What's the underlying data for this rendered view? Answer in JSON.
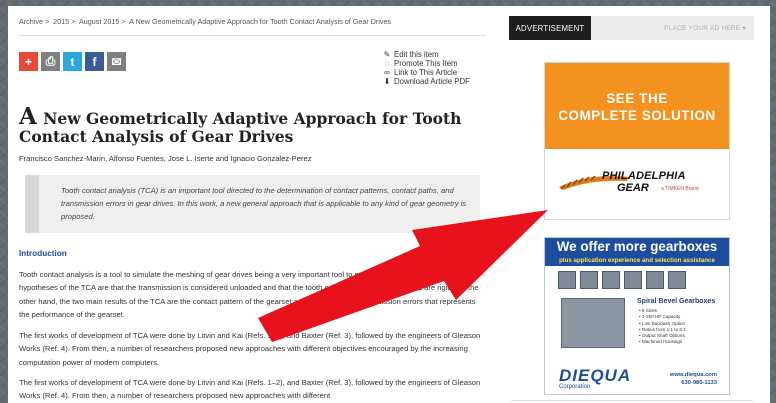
{
  "breadcrumb": {
    "items": [
      "Archive",
      "2015",
      "August 2015",
      "A New Geometrically Adaptive Approach for Tooth Contact Analysis of Gear Drives"
    ],
    "separator": ">"
  },
  "share": [
    {
      "name": "plus-icon",
      "glyph": "+"
    },
    {
      "name": "print-icon",
      "glyph": "⎙"
    },
    {
      "name": "twitter-icon",
      "glyph": "t"
    },
    {
      "name": "facebook-icon",
      "glyph": "f"
    },
    {
      "name": "mail-icon",
      "glyph": "✉"
    }
  ],
  "tools": [
    {
      "label": "Edit this item",
      "icon": "✎"
    },
    {
      "label": "Promote This Item",
      "icon": "◌"
    },
    {
      "label": "Link to This Article",
      "icon": "∞"
    },
    {
      "label": "Download Article PDF",
      "icon": "⬇"
    }
  ],
  "article": {
    "title_initial": "A",
    "title_rest": " New Geometrically Adaptive Approach for Tooth Contact Analysis of Gear Drives",
    "authors": "Francisco Sanchez-Marin, Alfonso Fuentes, Jose L. Iserte and Ignacio Gonzalez-Perez",
    "abstract": "Tooth contact analysis (TCA) is an important tool directed to the determination of contact patterns, contact paths, and transmission errors in gear drives. In this work, a new general approach that is applicable to any kind of gear geometry is proposed.",
    "intro_heading": "Introduction",
    "p1": "Tooth contact analysis is a tool to simulate the meshing of gear drives being a very important tool to predict performance. The main hypotheses of the TCA are that the transmission is considered unloaded and that the tooth contact surfaces of the gears are rigid. On the other hand, the two main results of the TCA are the contact pattern of the gearset and the function of transmission errors that represents the performance of the gearset.",
    "p2": "The first works of development of TCA were done by Litvin and Kai (Refs. 1–2), and Baxter (Ref. 3), followed by the engineers of Gleason Works (Ref. 4). From then, a number of researchers proposed new approaches with different objectives encouraged by the increasing computation power of modern computers.",
    "p3": "The first works of development of TCA were done by Litvin and Kai (Refs. 1–2), and Baxter (Ref. 3), followed by the engineers of Gleason Works (Ref. 4). From then, a number of researchers proposed new approaches with different"
  },
  "sidebar": {
    "ad_tab": "ADVERTISEMENT",
    "place_ad": "PLACE YOUR AD HERE ▾",
    "ad1": {
      "headline_1": "SEE THE",
      "headline_2": "COMPLETE SOLUTION",
      "brand_1": "PHILADELPHIA",
      "brand_2": "GEAR",
      "brand_3": "a TIMKEN Brand"
    },
    "ad2": {
      "headline": "We offer more gearboxes",
      "sub": "plus application experience and selection assistance",
      "product_title": "Spiral Bevel Gearboxes",
      "specs": [
        "• 9 Sizes",
        "• 1-250 HP Capacity",
        "• Low Backlash Option",
        "• Ratios from 1:1 to 6:1",
        "• Output Shaft Options",
        "• Machined Housings"
      ],
      "brand": "DIEQUA",
      "brand_sub": "Corporation",
      "web": "www.diequa.com",
      "phone": "630-980-1133"
    }
  },
  "colors": {
    "accent_arrow": "#e8121c",
    "link_blue": "#1b4a9a",
    "ad_orange": "#f49220",
    "ad_blue": "#1d4d9f"
  }
}
